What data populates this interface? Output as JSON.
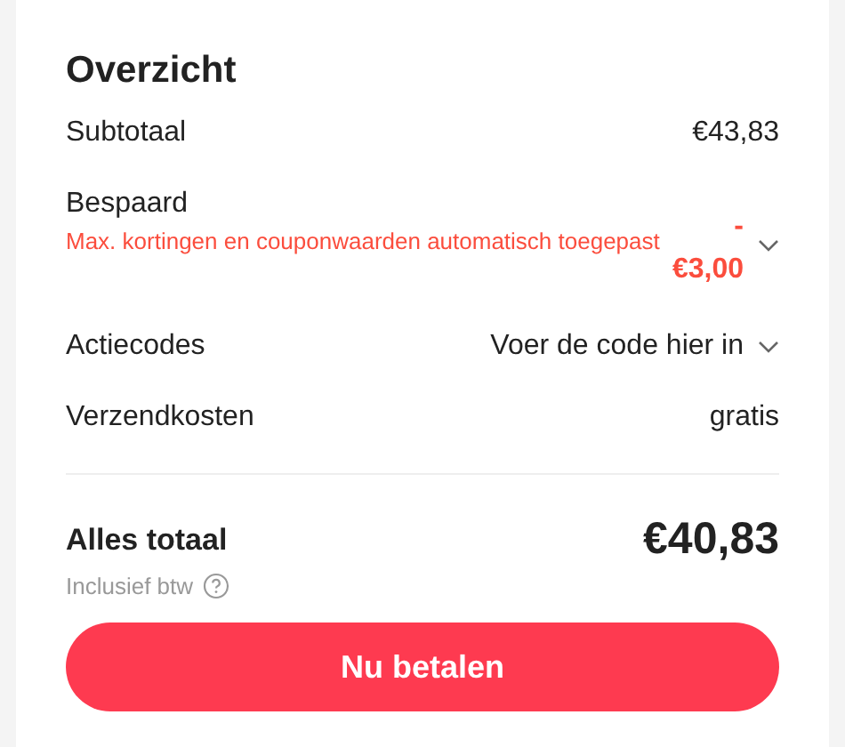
{
  "title": "Overzicht",
  "rows": [
    {
      "kind": "plain",
      "label": "Subtotaal",
      "value": "€43,83"
    },
    {
      "kind": "discount",
      "label": "Bespaard",
      "note": "Max. kortingen en couponwaarden automatisch toegepast",
      "value": "-\n€3,00",
      "expanded": false
    },
    {
      "kind": "select",
      "label": "Actiecodes",
      "value": "Voer de code hier in",
      "expanded": false
    },
    {
      "kind": "plain",
      "label": "Verzendkosten",
      "value": "gratis"
    }
  ],
  "total": {
    "label": "Alles totaal",
    "value": "€40,83",
    "note": "Inclusief btw"
  },
  "button": "Nu betalen"
}
